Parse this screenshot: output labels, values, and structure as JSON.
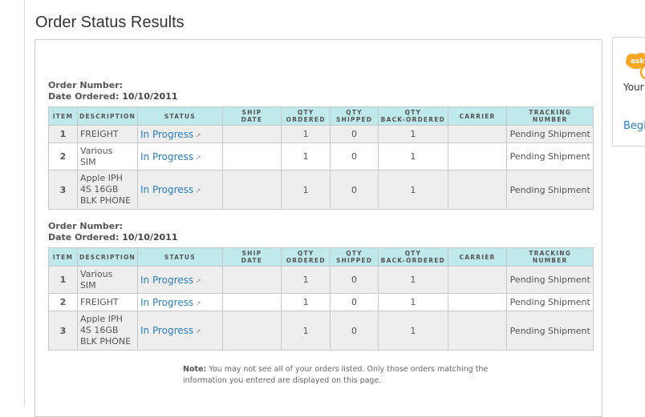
{
  "page": {
    "title": "Order Status Results"
  },
  "table_headers": {
    "item": "ITEM",
    "description": "DESCRIPTION",
    "status": "STATUS",
    "ship_date_1": "SHIP",
    "ship_date_2": "DATE",
    "qty_ordered_1": "QTY",
    "qty_ordered_2": "ORDERED",
    "qty_shipped_1": "QTY",
    "qty_shipped_2": "SHIPPED",
    "qty_back_1": "QTY",
    "qty_back_2": "BACK-ORDERED",
    "carrier": "CARRIER",
    "tracking_1": "TRACKING",
    "tracking_2": "NUMBER"
  },
  "orders": [
    {
      "order_number_label": "Order Number:",
      "order_number": "",
      "date_label": "Date Ordered:",
      "date": "10/10/2011",
      "rows": [
        {
          "item": "1",
          "desc": [
            "FREIGHT"
          ],
          "status": "In Progress",
          "ship_date": "",
          "qty_ordered": "1",
          "qty_shipped": "0",
          "qty_back": "1",
          "carrier": "",
          "tracking": "Pending Shipment"
        },
        {
          "item": "2",
          "desc": [
            "Various",
            "SIM"
          ],
          "status": "In Progress",
          "ship_date": "",
          "qty_ordered": "1",
          "qty_shipped": "0",
          "qty_back": "1",
          "carrier": "",
          "tracking": "Pending Shipment"
        },
        {
          "item": "3",
          "desc": [
            "Apple IPH",
            "4S 16GB",
            "BLK PHONE"
          ],
          "status": "In Progress",
          "ship_date": "",
          "qty_ordered": "1",
          "qty_shipped": "0",
          "qty_back": "1",
          "carrier": "",
          "tracking": "Pending Shipment"
        }
      ]
    },
    {
      "order_number_label": "Order Number:",
      "order_number": "",
      "date_label": "Date Ordered:",
      "date": "10/10/2011",
      "rows": [
        {
          "item": "1",
          "desc": [
            "Various",
            "SIM"
          ],
          "status": "In Progress",
          "ship_date": "",
          "qty_ordered": "1",
          "qty_shipped": "0",
          "qty_back": "1",
          "carrier": "",
          "tracking": "Pending Shipment"
        },
        {
          "item": "2",
          "desc": [
            "FREIGHT"
          ],
          "status": "In Progress",
          "ship_date": "",
          "qty_ordered": "1",
          "qty_shipped": "0",
          "qty_back": "1",
          "carrier": "",
          "tracking": "Pending Shipment"
        },
        {
          "item": "3",
          "desc": [
            "Apple IPH",
            "4S 16GB",
            "BLK PHONE"
          ],
          "status": "In Progress",
          "ship_date": "",
          "qty_ordered": "1",
          "qty_shipped": "0",
          "qty_back": "1",
          "carrier": "",
          "tracking": "Pending Shipment"
        }
      ]
    }
  ],
  "note": {
    "label": "Note:",
    "text": "You may not see all of your orders listed. Only those orders matching the information you entered are displayed on this page."
  },
  "sidebar": {
    "logo_icon": "ask-cloud-icon",
    "logo_word": "ask",
    "text": "Your",
    "link": "Begi",
    "accent": "#f5a623"
  },
  "colors": {
    "header_bg": "#bfe9ea",
    "link": "#2a7fbd",
    "odd_row": "#eeeeee"
  }
}
